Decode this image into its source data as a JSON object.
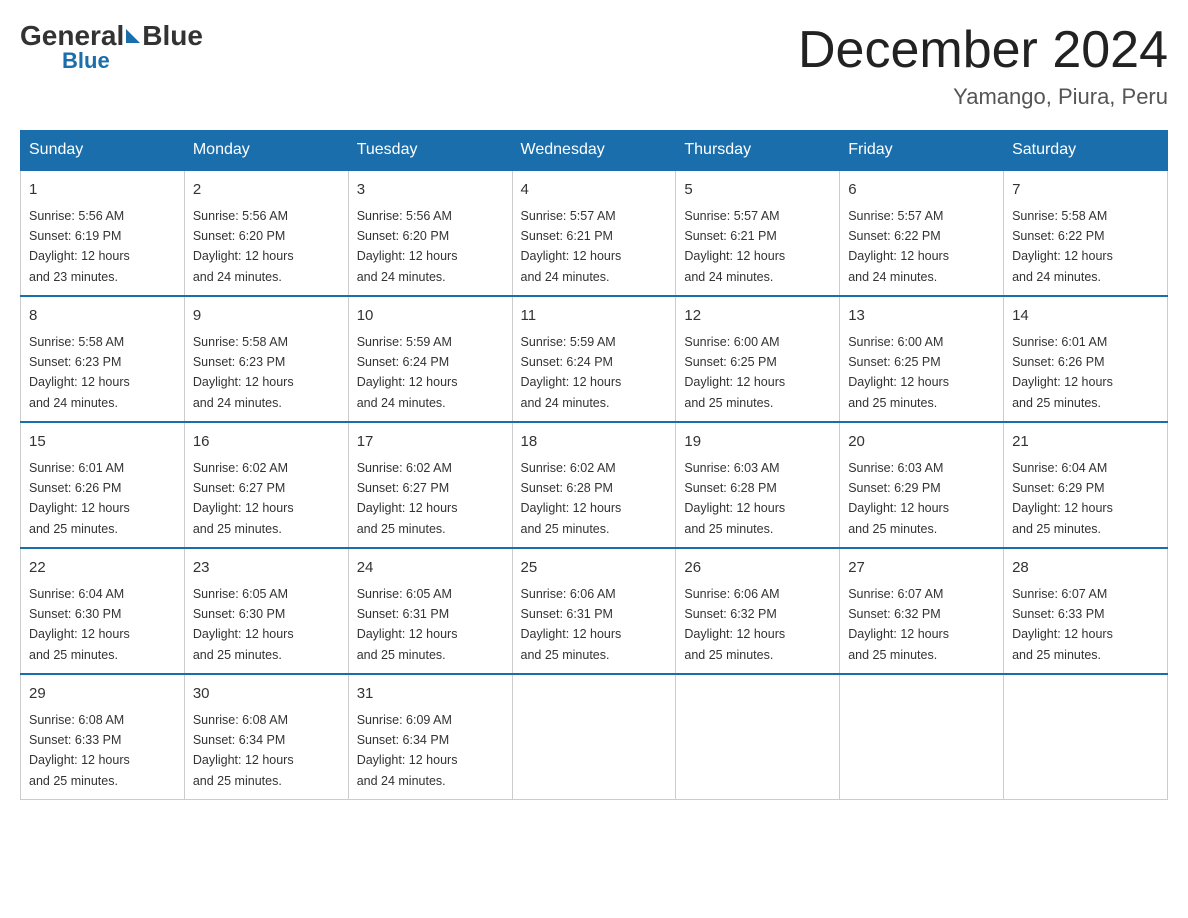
{
  "header": {
    "logo_general": "General",
    "logo_blue": "Blue",
    "title": "December 2024",
    "location": "Yamango, Piura, Peru"
  },
  "days_of_week": [
    "Sunday",
    "Monday",
    "Tuesday",
    "Wednesday",
    "Thursday",
    "Friday",
    "Saturday"
  ],
  "weeks": [
    [
      {
        "day": "1",
        "sunrise": "5:56 AM",
        "sunset": "6:19 PM",
        "daylight": "12 hours and 23 minutes."
      },
      {
        "day": "2",
        "sunrise": "5:56 AM",
        "sunset": "6:20 PM",
        "daylight": "12 hours and 24 minutes."
      },
      {
        "day": "3",
        "sunrise": "5:56 AM",
        "sunset": "6:20 PM",
        "daylight": "12 hours and 24 minutes."
      },
      {
        "day": "4",
        "sunrise": "5:57 AM",
        "sunset": "6:21 PM",
        "daylight": "12 hours and 24 minutes."
      },
      {
        "day": "5",
        "sunrise": "5:57 AM",
        "sunset": "6:21 PM",
        "daylight": "12 hours and 24 minutes."
      },
      {
        "day": "6",
        "sunrise": "5:57 AM",
        "sunset": "6:22 PM",
        "daylight": "12 hours and 24 minutes."
      },
      {
        "day": "7",
        "sunrise": "5:58 AM",
        "sunset": "6:22 PM",
        "daylight": "12 hours and 24 minutes."
      }
    ],
    [
      {
        "day": "8",
        "sunrise": "5:58 AM",
        "sunset": "6:23 PM",
        "daylight": "12 hours and 24 minutes."
      },
      {
        "day": "9",
        "sunrise": "5:58 AM",
        "sunset": "6:23 PM",
        "daylight": "12 hours and 24 minutes."
      },
      {
        "day": "10",
        "sunrise": "5:59 AM",
        "sunset": "6:24 PM",
        "daylight": "12 hours and 24 minutes."
      },
      {
        "day": "11",
        "sunrise": "5:59 AM",
        "sunset": "6:24 PM",
        "daylight": "12 hours and 24 minutes."
      },
      {
        "day": "12",
        "sunrise": "6:00 AM",
        "sunset": "6:25 PM",
        "daylight": "12 hours and 25 minutes."
      },
      {
        "day": "13",
        "sunrise": "6:00 AM",
        "sunset": "6:25 PM",
        "daylight": "12 hours and 25 minutes."
      },
      {
        "day": "14",
        "sunrise": "6:01 AM",
        "sunset": "6:26 PM",
        "daylight": "12 hours and 25 minutes."
      }
    ],
    [
      {
        "day": "15",
        "sunrise": "6:01 AM",
        "sunset": "6:26 PM",
        "daylight": "12 hours and 25 minutes."
      },
      {
        "day": "16",
        "sunrise": "6:02 AM",
        "sunset": "6:27 PM",
        "daylight": "12 hours and 25 minutes."
      },
      {
        "day": "17",
        "sunrise": "6:02 AM",
        "sunset": "6:27 PM",
        "daylight": "12 hours and 25 minutes."
      },
      {
        "day": "18",
        "sunrise": "6:02 AM",
        "sunset": "6:28 PM",
        "daylight": "12 hours and 25 minutes."
      },
      {
        "day": "19",
        "sunrise": "6:03 AM",
        "sunset": "6:28 PM",
        "daylight": "12 hours and 25 minutes."
      },
      {
        "day": "20",
        "sunrise": "6:03 AM",
        "sunset": "6:29 PM",
        "daylight": "12 hours and 25 minutes."
      },
      {
        "day": "21",
        "sunrise": "6:04 AM",
        "sunset": "6:29 PM",
        "daylight": "12 hours and 25 minutes."
      }
    ],
    [
      {
        "day": "22",
        "sunrise": "6:04 AM",
        "sunset": "6:30 PM",
        "daylight": "12 hours and 25 minutes."
      },
      {
        "day": "23",
        "sunrise": "6:05 AM",
        "sunset": "6:30 PM",
        "daylight": "12 hours and 25 minutes."
      },
      {
        "day": "24",
        "sunrise": "6:05 AM",
        "sunset": "6:31 PM",
        "daylight": "12 hours and 25 minutes."
      },
      {
        "day": "25",
        "sunrise": "6:06 AM",
        "sunset": "6:31 PM",
        "daylight": "12 hours and 25 minutes."
      },
      {
        "day": "26",
        "sunrise": "6:06 AM",
        "sunset": "6:32 PM",
        "daylight": "12 hours and 25 minutes."
      },
      {
        "day": "27",
        "sunrise": "6:07 AM",
        "sunset": "6:32 PM",
        "daylight": "12 hours and 25 minutes."
      },
      {
        "day": "28",
        "sunrise": "6:07 AM",
        "sunset": "6:33 PM",
        "daylight": "12 hours and 25 minutes."
      }
    ],
    [
      {
        "day": "29",
        "sunrise": "6:08 AM",
        "sunset": "6:33 PM",
        "daylight": "12 hours and 25 minutes."
      },
      {
        "day": "30",
        "sunrise": "6:08 AM",
        "sunset": "6:34 PM",
        "daylight": "12 hours and 25 minutes."
      },
      {
        "day": "31",
        "sunrise": "6:09 AM",
        "sunset": "6:34 PM",
        "daylight": "12 hours and 24 minutes."
      },
      null,
      null,
      null,
      null
    ]
  ],
  "labels": {
    "sunrise": "Sunrise:",
    "sunset": "Sunset:",
    "daylight": "Daylight:"
  }
}
